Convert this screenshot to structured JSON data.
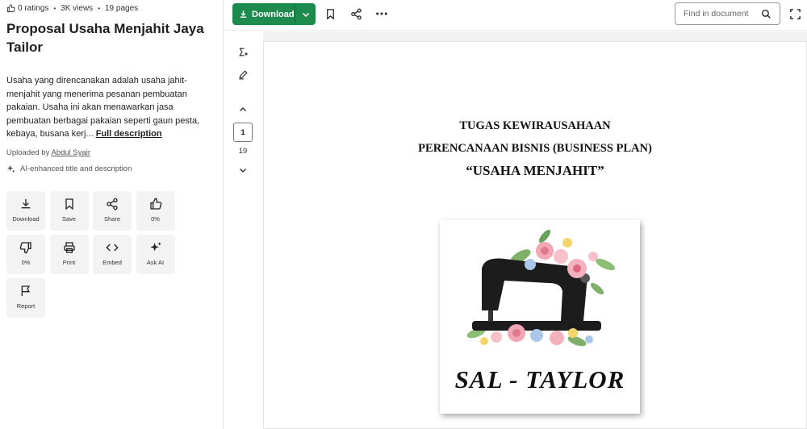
{
  "meta": {
    "ratings": "0 ratings",
    "views": "3K views",
    "pages": "19 pages"
  },
  "document": {
    "title": "Proposal Usaha Menjahit Jaya Tailor",
    "description": "Usaha yang direncanakan adalah usaha jahit-menjahit yang menerima pesanan pembuatan pakaian. Usaha ini akan menawarkan jasa pembuatan berbagai pakaian seperti gaun pesta, kebaya, busana kerj...",
    "full_description_link": "Full description",
    "uploaded_prefix": "Uploaded by",
    "uploader": "Abdul Syair",
    "ai_note": "AI-enhanced title and description"
  },
  "actions": [
    {
      "label": "Download",
      "icon": "download-icon"
    },
    {
      "label": "Save",
      "icon": "bookmark-icon"
    },
    {
      "label": "Share",
      "icon": "share-icon"
    },
    {
      "label": "0%",
      "icon": "thumbs-up-icon"
    },
    {
      "label": "0%",
      "icon": "thumbs-down-icon"
    },
    {
      "label": "Print",
      "icon": "print-icon"
    },
    {
      "label": "Embed",
      "icon": "embed-icon"
    },
    {
      "label": "Ask AI",
      "icon": "sparkle-icon"
    },
    {
      "label": "Report",
      "icon": "flag-icon"
    }
  ],
  "toolbar": {
    "download_label": "Download",
    "search_placeholder": "Find in document"
  },
  "pager": {
    "current": "1",
    "total": "19"
  },
  "page_content": {
    "line1": "TUGAS KEWIRAUSAHAAN",
    "line2": "PERENCANAAN BISNIS (BUSINESS PLAN)",
    "line3": "“USAHA MENJAHIT”",
    "logo_text": "SAL - TAYLOR"
  },
  "colors": {
    "accent": "#1d8a4e",
    "action_bg": "#f3f3f3"
  }
}
